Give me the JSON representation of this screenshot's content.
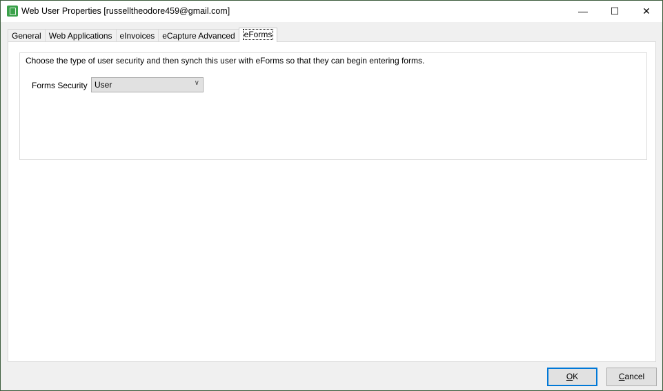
{
  "window": {
    "title": "Web User Properties [russelltheodore459@gmail.com]",
    "minimize": "—",
    "maximize": "☐",
    "close": "✕"
  },
  "tabs": [
    {
      "label": "General"
    },
    {
      "label": "Web Applications"
    },
    {
      "label": "eInvoices"
    },
    {
      "label": "eCapture Advanced"
    },
    {
      "label": "eForms",
      "active": true
    }
  ],
  "eforms": {
    "description": "Choose the type of user security and then synch this user with eForms so that they can begin entering forms.",
    "security_label": "Forms Security",
    "security_value": "User"
  },
  "buttons": {
    "ok_mnemonic": "O",
    "ok_rest": "K",
    "cancel_mnemonic": "C",
    "cancel_rest": "ancel"
  },
  "colors": {
    "accent": "#0078d7",
    "app_icon": "#3aa14a"
  }
}
